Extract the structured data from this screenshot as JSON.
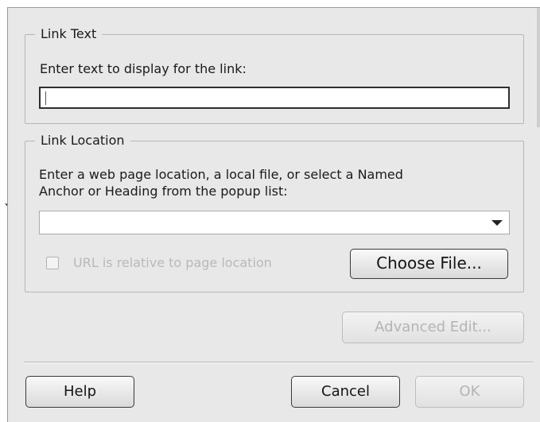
{
  "dialog": {
    "link_text_group": {
      "legend": "Link Text",
      "prompt": "Enter text to display for the link:",
      "value": ""
    },
    "link_location_group": {
      "legend": "Link Location",
      "prompt_line1": "Enter a web page location, a local file, or select a Named",
      "prompt_line2": "Anchor or Heading from the popup list:",
      "value": "",
      "checkbox_label": "URL is relative to page location",
      "checkbox_checked": false,
      "choose_file_label": "Choose File..."
    },
    "advanced_edit_label": "Advanced Edit...",
    "buttons": {
      "help": "Help",
      "cancel": "Cancel",
      "ok": "OK"
    }
  },
  "icons": {
    "pointer": "arrow-pointer-icon",
    "dropdown": "chevron-down-icon"
  },
  "colors": {
    "dialog_bg": "#e8e8e8",
    "disabled_text": "#b4b4b4"
  }
}
